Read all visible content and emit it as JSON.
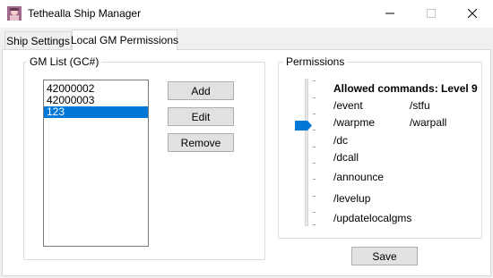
{
  "window": {
    "title": "Tethealla Ship Manager",
    "icon": "app-icon"
  },
  "tabs": [
    {
      "label": "Ship Settings",
      "active": false
    },
    {
      "label": "Local GM Permissions",
      "active": true
    }
  ],
  "gm_list": {
    "group_label": "GM List (GC#)",
    "items": [
      {
        "value": "42000002",
        "selected": false
      },
      {
        "value": "42000003",
        "selected": false
      },
      {
        "value": "123",
        "selected": true
      }
    ],
    "buttons": {
      "add": "Add",
      "edit": "Edit",
      "remove": "Remove"
    }
  },
  "permissions": {
    "group_label": "Permissions",
    "heading": "Allowed commands: Level 9",
    "level": 9,
    "commands": [
      "/event",
      "/stfu",
      "/warpme",
      "/warpall",
      "/dc",
      "/dcall",
      "/announce",
      "/levelup",
      "/updatelocalgms"
    ],
    "save": "Save",
    "colors": {
      "accent": "#0078d7"
    }
  }
}
